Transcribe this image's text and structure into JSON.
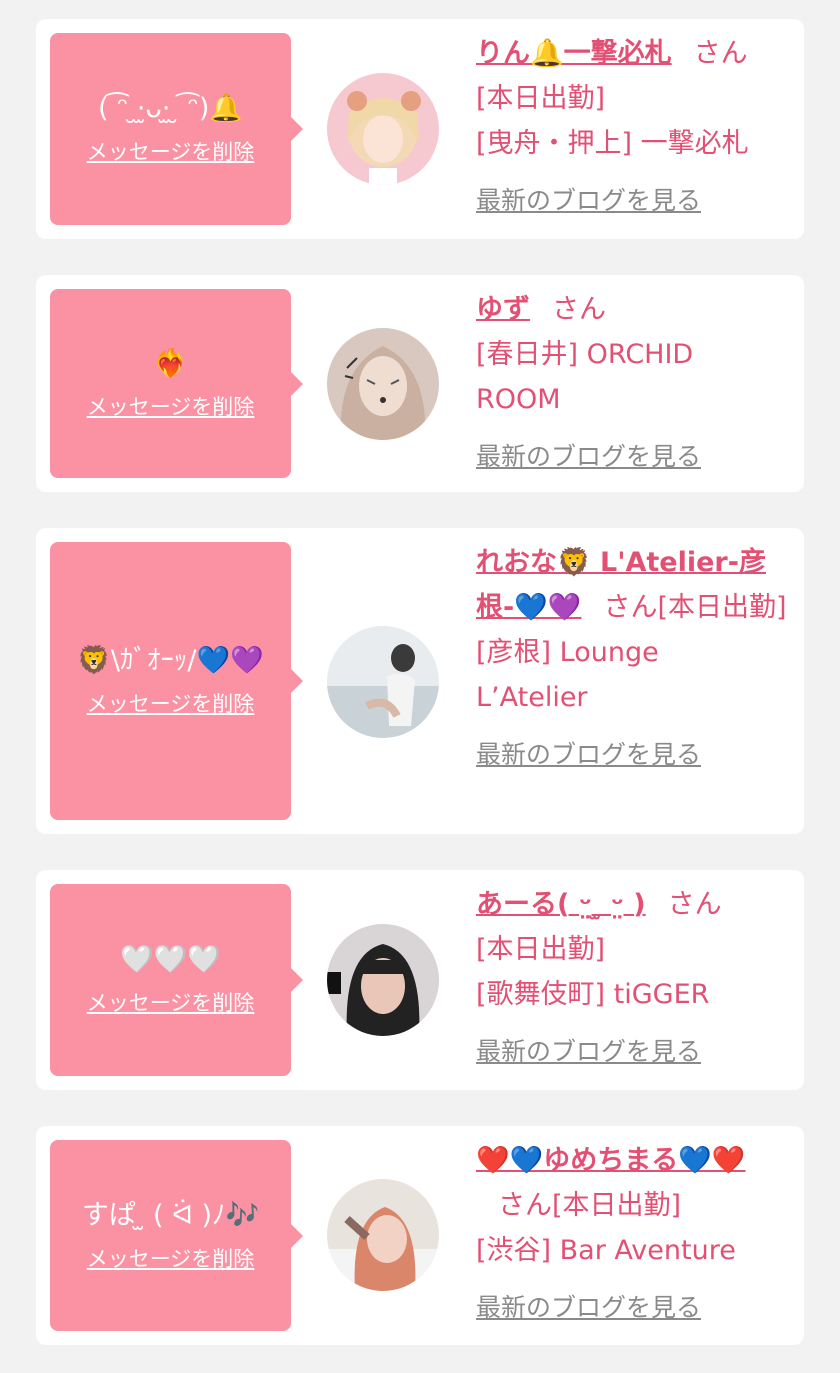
{
  "delete_label": "メッセージを削除",
  "blog_label": "最新のブログを見る",
  "honorific": "さん",
  "items": [
    {
      "message": "( ͡ᵔ ̮·̫ᴗ·̫ ̮ ͡ᵔ)🔔",
      "name": "りん🔔一撃必札",
      "status": "[本日出勤]",
      "shop": "[曳舟・押上] 一撃必札",
      "avatar_colors": [
        "#f6c9d0",
        "#f3d9b5",
        "#e5a080"
      ]
    },
    {
      "message": "❤️‍🔥",
      "name": "ゆず",
      "status": "",
      "shop": "[春日井] ORCHID ROOM",
      "avatar_colors": [
        "#d8c8c0",
        "#c9b0a0",
        "#a08070"
      ]
    },
    {
      "message": "🦁\\ｶﾞｵｰｯ/💙💜",
      "name": "れおな🦁 L'Atelier-彦根-💙💜",
      "status": "[本日出勤]",
      "shop": "[彦根] Lounge L’Atelier",
      "avatar_colors": [
        "#e8ecee",
        "#c9d2d6",
        "#3a3a3a"
      ]
    },
    {
      "message": "🤍🤍🤍",
      "name": "あーる( ᵕ̤ ̫ ᵕ̤ )",
      "status": "[本日出勤]",
      "shop": "[歌舞伎町] tiGGER",
      "avatar_colors": [
        "#d9d4d6",
        "#222222",
        "#e9c6b8"
      ]
    },
    {
      "message": "すぱ ̫ ( ᐛ )ﾉ🎶",
      "name": "❤️💙ゆめちまる💙❤️",
      "status": "[本日出勤]",
      "shop": "[渋谷] Bar Aventure",
      "avatar_colors": [
        "#e9e3de",
        "#d9866a",
        "#8a6a60"
      ]
    }
  ]
}
